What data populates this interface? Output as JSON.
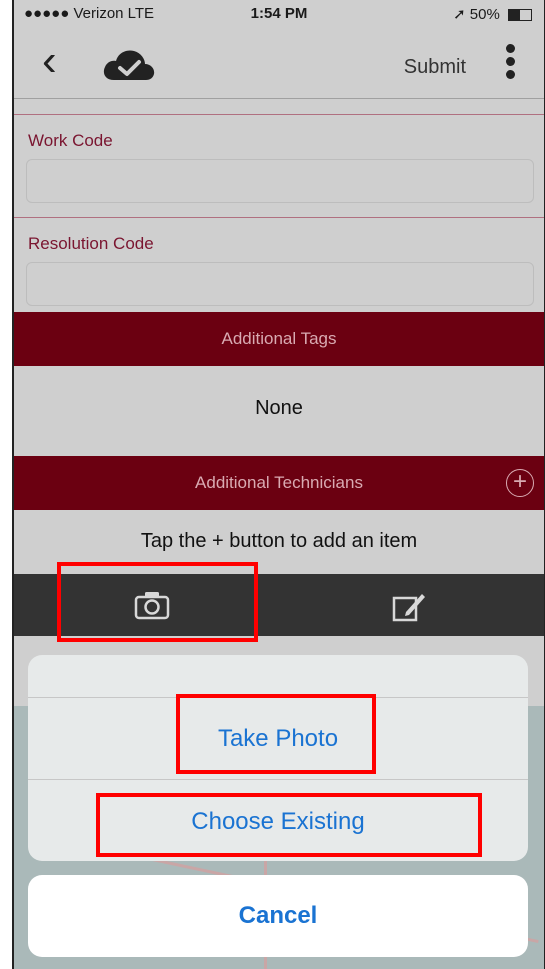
{
  "status_bar": {
    "carrier": "●●●●● Verizon  LTE",
    "time": "1:54 PM",
    "battery": "➚ 50%"
  },
  "nav": {
    "submit": "Submit"
  },
  "form": {
    "work_code_label": "Work Code",
    "resolution_code_label": "Resolution Code",
    "additional_tags_title": "Additional Tags",
    "additional_tags_value": "None",
    "additional_technicians_title": "Additional Technicians",
    "add_item_hint": "Tap the + button to add an item"
  },
  "action_sheet": {
    "take_photo": "Take Photo",
    "choose_existing": "Choose Existing",
    "cancel": "Cancel"
  },
  "colors": {
    "accent": "#6b0011",
    "label": "#7a1530",
    "ios_blue": "#1a73d2",
    "highlight": "#ff0000"
  }
}
